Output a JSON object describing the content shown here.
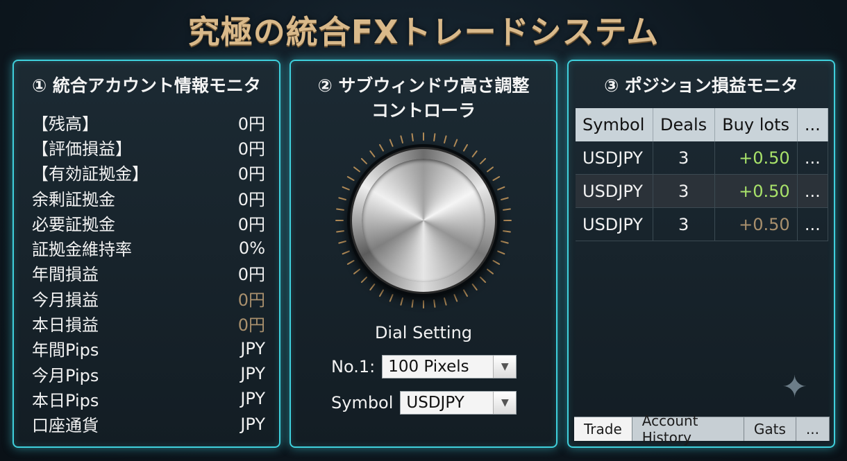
{
  "title": "究極の統合FXトレードシステム",
  "panels": {
    "account": {
      "title": "① 統合アカウント情報モニタ",
      "rows": [
        {
          "label": "【残高】",
          "value": "0円"
        },
        {
          "label": "【評価損益】",
          "value": "0円"
        },
        {
          "label": "【有効証拠金】",
          "value": "0円"
        },
        {
          "label": "余剰証拠金",
          "value": "0円"
        },
        {
          "label": "必要証拠金",
          "value": "0円"
        },
        {
          "label": "証拠金維持率",
          "value": "0%"
        },
        {
          "label": "年間損益",
          "value": "0円"
        },
        {
          "label": "今月損益",
          "value": "0円"
        },
        {
          "label": "本日損益",
          "value": "0円"
        },
        {
          "label": "年間Pips",
          "value": "JPY"
        },
        {
          "label": "今月Pips",
          "value": "JPY"
        },
        {
          "label": "本日Pips",
          "value": "JPY"
        },
        {
          "label": "口座通貨",
          "value": "JPY"
        }
      ]
    },
    "dial": {
      "title_line1": "② サブウィンドウ高さ調整",
      "title_line2": "コントローラ",
      "dial_label": "Dial Setting",
      "no1_label": "No.1:",
      "no1_value": "100 Pixels",
      "symbol_label": "Symbol",
      "symbol_value": "USDJPY"
    },
    "positions": {
      "title": "③ ポジション損益モニタ",
      "headers": [
        "Symbol",
        "Deals",
        "Buy lots",
        "..."
      ],
      "rows": [
        {
          "symbol": "USDJPY",
          "deals": "3",
          "buy_lots": "+0.50",
          "more": "..."
        },
        {
          "symbol": "USDJPY",
          "deals": "3",
          "buy_lots": "+0.50",
          "more": "..."
        },
        {
          "symbol": "USDJPY",
          "deals": "3",
          "buy_lots": "+0.50",
          "more": "..."
        }
      ],
      "tabs": [
        "Trade",
        "Account History",
        "Gats",
        "..."
      ]
    }
  },
  "colors": {
    "accent": "#3fd0dc",
    "title_gold": "#d9b98a",
    "profit_green": "#a9e36a",
    "muted_value": "#a9906d"
  },
  "icons": {
    "sparkle": "sparkle-icon",
    "dropdown": "chevron-down-icon"
  }
}
